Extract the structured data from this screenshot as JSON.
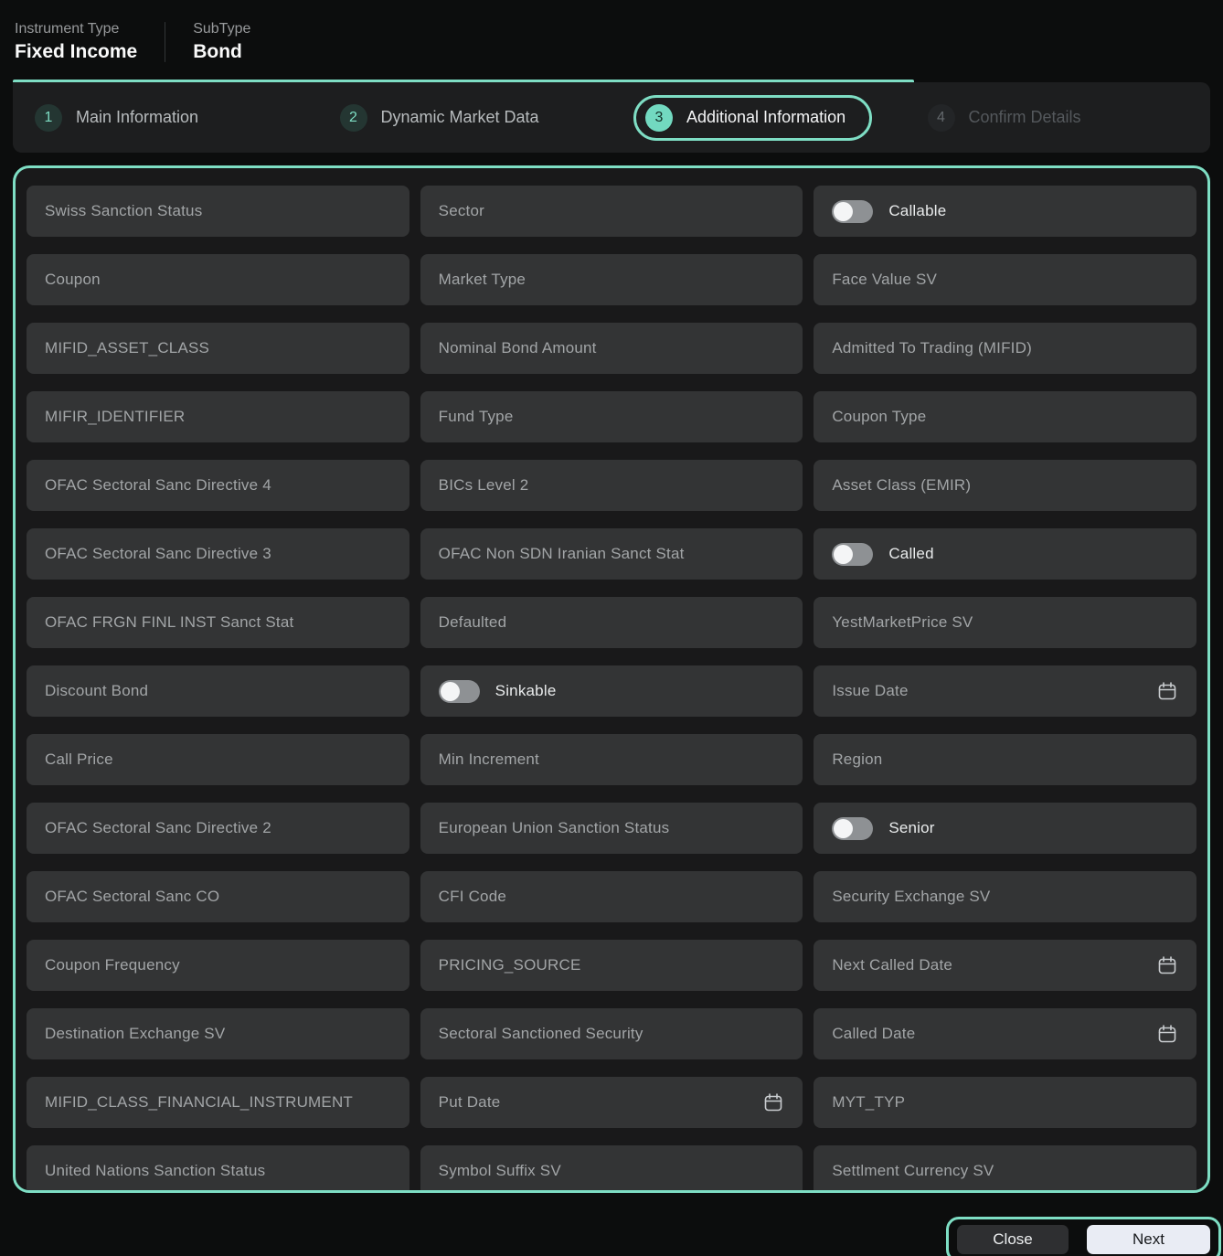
{
  "header": {
    "instrument_type_label": "Instrument Type",
    "instrument_type_value": "Fixed Income",
    "subtype_label": "SubType",
    "subtype_value": "Bond"
  },
  "stepper": {
    "steps": [
      {
        "number": "1",
        "label": "Main Information",
        "state": "done"
      },
      {
        "number": "2",
        "label": "Dynamic Market Data",
        "state": "done"
      },
      {
        "number": "3",
        "label": "Additional Information",
        "state": "active"
      },
      {
        "number": "4",
        "label": "Confirm Details",
        "state": "upcoming"
      }
    ]
  },
  "form": {
    "fields": [
      {
        "label": "Swiss Sanction Status",
        "type": "text"
      },
      {
        "label": "Sector",
        "type": "text"
      },
      {
        "label": "Callable",
        "type": "toggle",
        "on": false
      },
      {
        "label": "Coupon",
        "type": "text"
      },
      {
        "label": "Market Type",
        "type": "text"
      },
      {
        "label": "Face Value SV",
        "type": "text"
      },
      {
        "label": "MIFID_ASSET_CLASS",
        "type": "text"
      },
      {
        "label": "Nominal Bond Amount",
        "type": "text"
      },
      {
        "label": "Admitted To Trading (MIFID)",
        "type": "text"
      },
      {
        "label": "MIFIR_IDENTIFIER",
        "type": "text"
      },
      {
        "label": "Fund Type",
        "type": "text"
      },
      {
        "label": "Coupon Type",
        "type": "text"
      },
      {
        "label": "OFAC Sectoral Sanc Directive 4",
        "type": "text"
      },
      {
        "label": "BICs Level 2",
        "type": "text"
      },
      {
        "label": "Asset Class (EMIR)",
        "type": "text"
      },
      {
        "label": "OFAC Sectoral Sanc Directive 3",
        "type": "text"
      },
      {
        "label": "OFAC Non SDN Iranian Sanct Stat",
        "type": "text"
      },
      {
        "label": "Called",
        "type": "toggle",
        "on": false
      },
      {
        "label": "OFAC FRGN FINL INST Sanct Stat",
        "type": "text"
      },
      {
        "label": "Defaulted",
        "type": "text"
      },
      {
        "label": "YestMarketPrice SV",
        "type": "text"
      },
      {
        "label": "Discount Bond",
        "type": "text"
      },
      {
        "label": "Sinkable",
        "type": "toggle",
        "on": false
      },
      {
        "label": "Issue Date",
        "type": "date"
      },
      {
        "label": "Call Price",
        "type": "text"
      },
      {
        "label": "Min Increment",
        "type": "text"
      },
      {
        "label": "Region",
        "type": "text"
      },
      {
        "label": "OFAC Sectoral Sanc Directive 2",
        "type": "text"
      },
      {
        "label": "European Union Sanction Status",
        "type": "text"
      },
      {
        "label": "Senior",
        "type": "toggle",
        "on": false
      },
      {
        "label": "OFAC Sectoral Sanc CO",
        "type": "text"
      },
      {
        "label": "CFI Code",
        "type": "text"
      },
      {
        "label": "Security Exchange SV",
        "type": "text"
      },
      {
        "label": "Coupon Frequency",
        "type": "text"
      },
      {
        "label": "PRICING_SOURCE",
        "type": "text"
      },
      {
        "label": "Next Called Date",
        "type": "date"
      },
      {
        "label": "Destination Exchange SV",
        "type": "text"
      },
      {
        "label": "Sectoral Sanctioned Security",
        "type": "text"
      },
      {
        "label": "Called Date",
        "type": "date"
      },
      {
        "label": "MIFID_CLASS_FINANCIAL_INSTRUMENT",
        "type": "text"
      },
      {
        "label": "Put Date",
        "type": "date"
      },
      {
        "label": "MYT_TYP",
        "type": "text"
      },
      {
        "label": "United Nations Sanction Status",
        "type": "text"
      },
      {
        "label": "Symbol Suffix SV",
        "type": "text"
      },
      {
        "label": "Settlment Currency SV",
        "type": "text"
      }
    ]
  },
  "footer": {
    "close_label": "Close",
    "next_label": "Next"
  },
  "colors": {
    "accent": "#7EDEC4",
    "active_step_fill": "#72D9C0",
    "field_background": "#333435",
    "panel_background": "#19191A",
    "next_button_background": "#E9ECF4"
  }
}
